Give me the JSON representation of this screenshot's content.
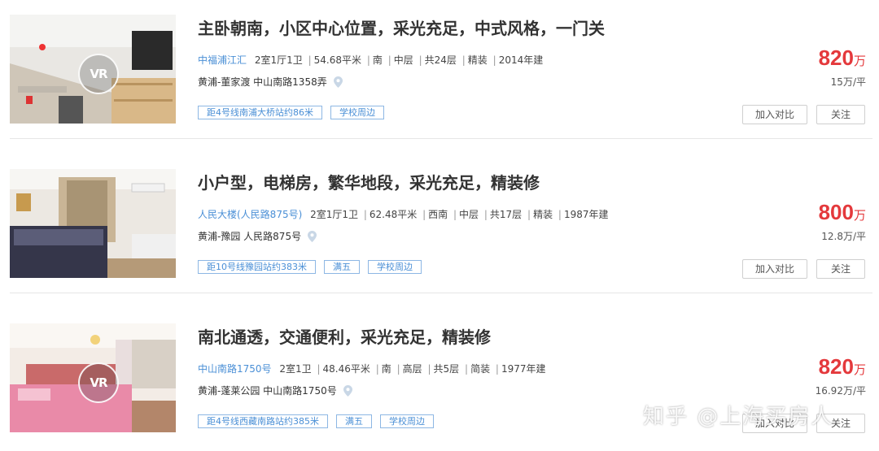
{
  "listings": [
    {
      "title": "主卧朝南，小区中心位置，采光充足，中式风格，一门关",
      "community": "中福浦江汇",
      "details": [
        "2室1厅1卫",
        "54.68平米",
        "南",
        "中层",
        "共24层",
        "精装",
        "2014年建"
      ],
      "district": "黄浦-董家渡",
      "address": "中山南路1358弄",
      "tags": [
        "距4号线南浦大桥站约86米",
        "学校周边"
      ],
      "price": "820",
      "price_unit": "万",
      "unit_price": "15万/平",
      "photo_icon": "vr-icon"
    },
    {
      "title": "小户型，电梯房，繁华地段，采光充足，精装修",
      "community": "人民大楼(人民路875号)",
      "details": [
        "2室1厅1卫",
        "62.48平米",
        "西南",
        "中层",
        "共17层",
        "精装",
        "1987年建"
      ],
      "district": "黄浦-豫园",
      "address": "人民路875号",
      "tags": [
        "距10号线豫园站约383米",
        "满五",
        "学校周边"
      ],
      "price": "800",
      "price_unit": "万",
      "unit_price": "12.8万/平",
      "photo_icon": ""
    },
    {
      "title": "南北通透，交通便利，采光充足，精装修",
      "community": "中山南路1750号",
      "details": [
        "2室1卫",
        "48.46平米",
        "南",
        "高层",
        "共5层",
        "简装",
        "1977年建"
      ],
      "district": "黄浦-蓬莱公园",
      "address": "中山南路1750号",
      "tags": [
        "距4号线西藏南路站约385米",
        "满五",
        "学校周边"
      ],
      "price": "820",
      "price_unit": "万",
      "unit_price": "16.92万/平",
      "photo_icon": "vr-icon"
    }
  ],
  "buttons": {
    "compare": "加入对比",
    "follow": "关注"
  },
  "vr_label": "VR",
  "watermark": "知乎 @上海买房人",
  "colors": {
    "price": "#e4393c",
    "link": "#4a8fd6",
    "tag_border": "#8db7e4"
  }
}
